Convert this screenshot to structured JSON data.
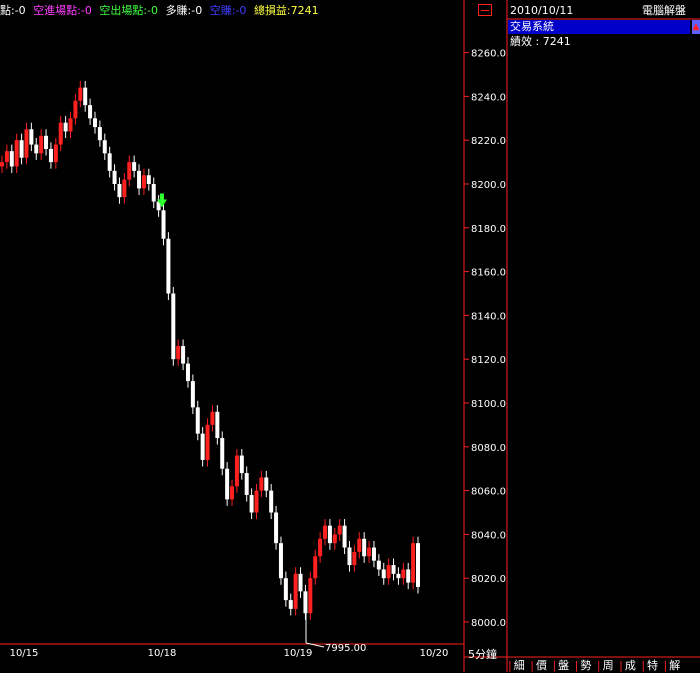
{
  "status_bar": [
    {
      "text": "點:-0",
      "color": "#ffffff"
    },
    {
      "text": "空進場點:-0",
      "color": "#ff40ff"
    },
    {
      "text": "空出場點:-0",
      "color": "#40ff40"
    },
    {
      "text": "多賺:-0",
      "color": "#ffffff"
    },
    {
      "text": "空賺:-0",
      "color": "#4040ff"
    },
    {
      "text": "總損益:7241",
      "color": "#ffff40"
    }
  ],
  "side_panel": {
    "date": "2010/10/11",
    "title": "電腦解盤",
    "system_label": "交易系統",
    "performance": "績效 : 7241"
  },
  "timeframe": "5分鐘",
  "bottom_tabs": [
    "細",
    "價",
    "盤",
    "勢",
    "周",
    "成",
    "特",
    "解"
  ],
  "chart_data": {
    "type": "candlestick",
    "x_labels": [
      "10/15",
      "10/18",
      "10/19",
      "10/20"
    ],
    "y_ticks": [
      8000.0,
      8020.0,
      8040.0,
      8060.0,
      8080.0,
      8100.0,
      8120.0,
      8140.0,
      8160.0,
      8180.0,
      8200.0,
      8220.0,
      8240.0,
      8260.0
    ],
    "ylim": [
      7995,
      8270
    ],
    "annotations": [
      {
        "text": "7995.00",
        "value": 7995.0
      }
    ],
    "signals": [
      {
        "type": "short-entry-arrow",
        "price": 8192
      }
    ],
    "series": [
      {
        "c": 8210
      },
      {
        "c": 8215
      },
      {
        "c": 8208
      },
      {
        "c": 8220
      },
      {
        "c": 8212
      },
      {
        "c": 8225
      },
      {
        "c": 8218
      },
      {
        "c": 8214
      },
      {
        "c": 8222
      },
      {
        "c": 8216
      },
      {
        "c": 8210
      },
      {
        "c": 8218
      },
      {
        "c": 8228
      },
      {
        "c": 8224
      },
      {
        "c": 8230
      },
      {
        "c": 8238
      },
      {
        "c": 8244
      },
      {
        "c": 8236
      },
      {
        "c": 8230
      },
      {
        "c": 8226
      },
      {
        "c": 8220
      },
      {
        "c": 8214
      },
      {
        "c": 8206
      },
      {
        "c": 8200
      },
      {
        "c": 8194
      },
      {
        "c": 8202
      },
      {
        "c": 8210
      },
      {
        "c": 8206
      },
      {
        "c": 8198
      },
      {
        "c": 8204
      },
      {
        "c": 8200
      },
      {
        "c": 8192
      },
      {
        "c": 8188
      },
      {
        "c": 8175
      },
      {
        "c": 8150
      },
      {
        "c": 8120
      },
      {
        "c": 8126
      },
      {
        "c": 8118
      },
      {
        "c": 8110
      },
      {
        "c": 8098
      },
      {
        "c": 8086
      },
      {
        "c": 8074
      },
      {
        "c": 8090
      },
      {
        "c": 8096
      },
      {
        "c": 8084
      },
      {
        "c": 8070
      },
      {
        "c": 8056
      },
      {
        "c": 8062
      },
      {
        "c": 8076
      },
      {
        "c": 8068
      },
      {
        "c": 8058
      },
      {
        "c": 8050
      },
      {
        "c": 8060
      },
      {
        "c": 8066
      },
      {
        "c": 8060
      },
      {
        "c": 8050
      },
      {
        "c": 8036
      },
      {
        "c": 8020
      },
      {
        "c": 8010
      },
      {
        "c": 8006
      },
      {
        "c": 8022
      },
      {
        "c": 8014
      },
      {
        "c": 8004
      },
      {
        "c": 8020
      },
      {
        "c": 8030
      },
      {
        "c": 8038
      },
      {
        "c": 8044
      },
      {
        "c": 8036
      },
      {
        "c": 8040
      },
      {
        "c": 8044
      },
      {
        "c": 8034
      },
      {
        "c": 8026
      },
      {
        "c": 8032
      },
      {
        "c": 8038
      },
      {
        "c": 8030
      },
      {
        "c": 8034
      },
      {
        "c": 8028
      },
      {
        "c": 8024
      },
      {
        "c": 8020
      },
      {
        "c": 8026
      },
      {
        "c": 8022
      },
      {
        "c": 8020
      },
      {
        "c": 8024
      },
      {
        "c": 8018
      },
      {
        "c": 8036
      },
      {
        "c": 8016
      }
    ]
  }
}
